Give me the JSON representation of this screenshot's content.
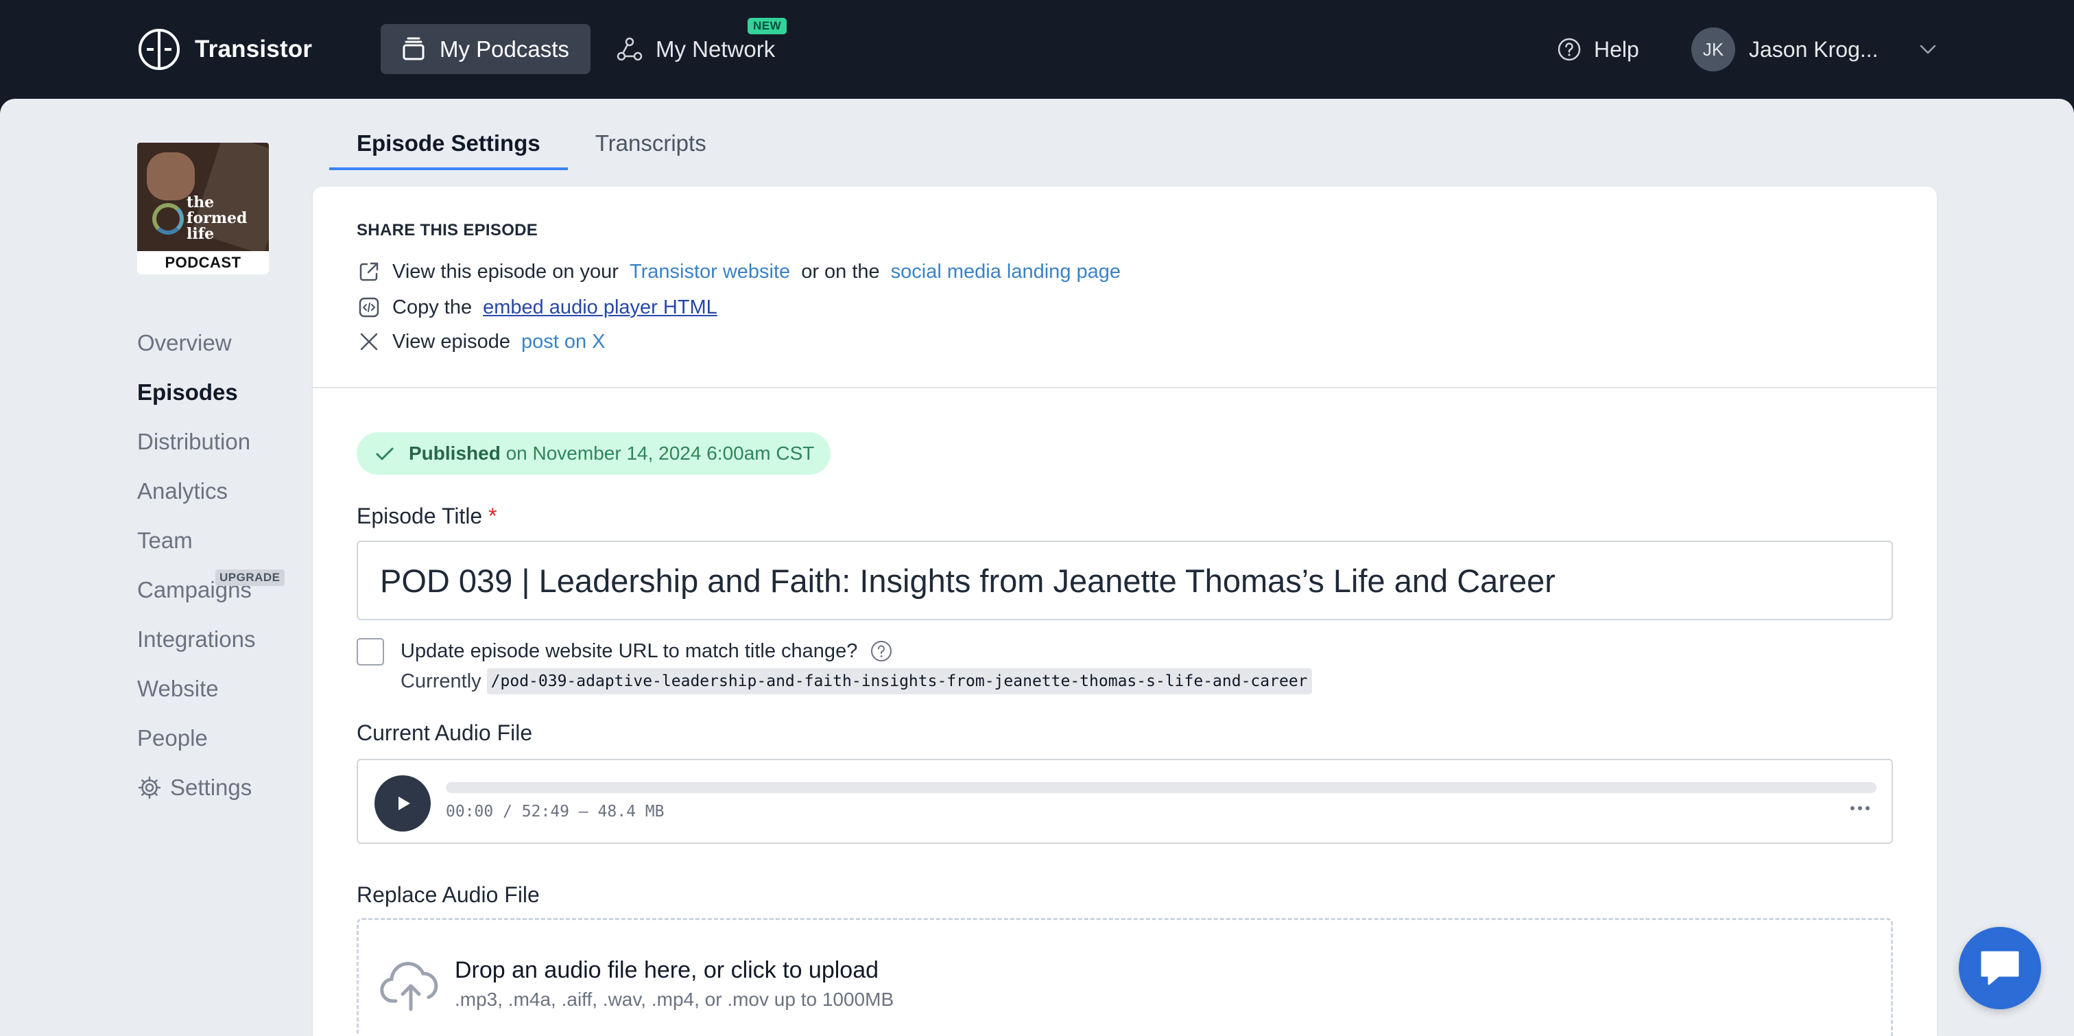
{
  "brand": {
    "name": "Transistor"
  },
  "topnav": {
    "my_podcasts": "My Podcasts",
    "my_network": "My Network",
    "new_badge": "NEW",
    "help": "Help",
    "user_initials": "JK",
    "user_name": "Jason Krog..."
  },
  "podcast_cover": {
    "title_line1": "the",
    "title_line2": "formed",
    "title_line3": "life",
    "label": "PODCAST"
  },
  "sidebar": {
    "items": [
      {
        "label": "Overview"
      },
      {
        "label": "Episodes"
      },
      {
        "label": "Distribution"
      },
      {
        "label": "Analytics"
      },
      {
        "label": "Team"
      },
      {
        "label": "Campaigns",
        "badge": "UPGRADE"
      },
      {
        "label": "Integrations"
      },
      {
        "label": "Website"
      },
      {
        "label": "People"
      },
      {
        "label": "Settings"
      }
    ],
    "active": "Episodes"
  },
  "tabs": [
    {
      "label": "Episode Settings"
    },
    {
      "label": "Transcripts"
    }
  ],
  "share": {
    "heading": "SHARE THIS EPISODE",
    "row1_prefix": "View this episode on your",
    "row1_link1": "Transistor website",
    "row1_mid": "or on the",
    "row1_link2": "social media landing page",
    "row2_prefix": "Copy the",
    "row2_link": "embed audio player HTML",
    "row3_prefix": "View episode",
    "row3_link": "post on X"
  },
  "status": {
    "label": "Published",
    "text": "on November 14, 2024 6:00am CST",
    "color": "#2f855a"
  },
  "episode": {
    "title_label": "Episode Title",
    "required_mark": "*",
    "title_value": "POD 039 | Leadership and Faith: Insights from Jeanette Thomas’s Life and Career",
    "url_checkbox_label": "Update episode website URL to match title change?",
    "currently_label": "Currently",
    "slug": "/pod-039-adaptive-leadership-and-faith-insights-from-jeanette-thomas-s-life-and-career"
  },
  "audio": {
    "heading": "Current Audio File",
    "time": "00:00 / 52:49 — 48.4 MB",
    "progress": 0
  },
  "replace": {
    "heading": "Replace Audio File",
    "drop_title": "Drop an audio file here, or click to upload",
    "drop_sub": ".mp3, .m4a, .aiff, .wav, .mp4, or .mov up to 1000MB"
  },
  "colors": {
    "accent": "#3b82f6",
    "nav_bg": "#141b27",
    "link": "#3b82c4",
    "chat": "#2b6cd6"
  }
}
